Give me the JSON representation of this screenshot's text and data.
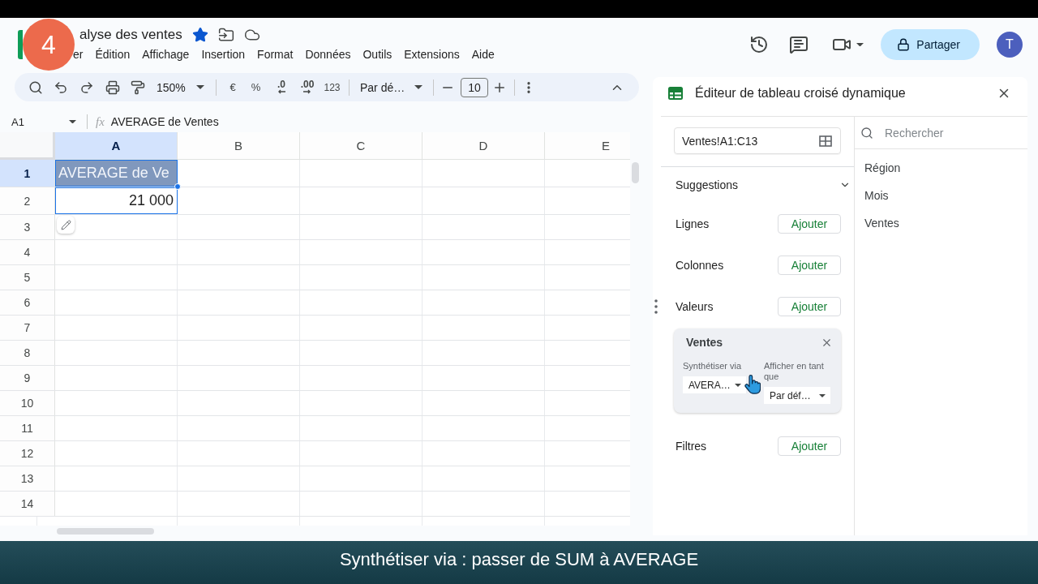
{
  "badge": {
    "text": "4"
  },
  "header": {
    "title": "alyse des ventes",
    "starred": true,
    "menu": [
      {
        "label": "er"
      },
      {
        "label": "Édition"
      },
      {
        "label": "Affichage"
      },
      {
        "label": "Insertion"
      },
      {
        "label": "Format"
      },
      {
        "label": "Données"
      },
      {
        "label": "Outils"
      },
      {
        "label": "Extensions"
      },
      {
        "label": "Aide"
      }
    ]
  },
  "share": {
    "label": "Partager"
  },
  "avatar": {
    "initial": "T"
  },
  "toolbar": {
    "zoom": "150%",
    "currency": "€",
    "percent": "%",
    "decimal_decrease": ".0",
    "decimal_increase": ".00",
    "number_format": "123",
    "font": "Par dé…",
    "font_size": "10"
  },
  "formula_bar": {
    "cell_ref": "A1",
    "function_label": "fx",
    "formula": "AVERAGE de Ventes"
  },
  "sheet": {
    "columns": [
      {
        "label": "A",
        "selected": true
      },
      {
        "label": "B",
        "selected": false
      },
      {
        "label": "C",
        "selected": false
      },
      {
        "label": "D",
        "selected": false
      },
      {
        "label": "E",
        "selected": false
      }
    ],
    "rows": [
      {
        "label": "1",
        "selected": true,
        "cells": [
          {
            "value": "AVERAGE de Ve",
            "kind": "header",
            "selected": true,
            "active": true
          }
        ]
      },
      {
        "label": "2",
        "selected": false,
        "cells": [
          {
            "value": "21 000",
            "kind": "number",
            "selected": true,
            "active": false
          }
        ]
      },
      {
        "label": "3",
        "selected": false
      },
      {
        "label": "4",
        "selected": false
      },
      {
        "label": "5",
        "selected": false
      },
      {
        "label": "6",
        "selected": false
      },
      {
        "label": "7",
        "selected": false
      },
      {
        "label": "8",
        "selected": false
      },
      {
        "label": "9",
        "selected": false
      },
      {
        "label": "10",
        "selected": false
      },
      {
        "label": "11",
        "selected": false
      },
      {
        "label": "12",
        "selected": false
      },
      {
        "label": "13",
        "selected": false
      },
      {
        "label": "14",
        "selected": false
      }
    ]
  },
  "pivot_editor": {
    "title": "Éditeur de tableau croisé dynamique",
    "range": "Ventes!A1:C13",
    "suggestions": {
      "label": "Suggestions",
      "expanded": false
    },
    "sections": [
      {
        "label": "Lignes",
        "button": "Ajouter"
      },
      {
        "label": "Colonnes",
        "button": "Ajouter"
      },
      {
        "label": "Valeurs",
        "button": "Ajouter",
        "cards": [
          {
            "title": "Ventes",
            "summarize_label": "Synthétiser via",
            "summarize_value": "AVERA…",
            "show_as_label": "Afficher en tant que",
            "show_as_value": "Par déf…"
          }
        ]
      },
      {
        "label": "Filtres",
        "button": "Ajouter"
      }
    ]
  },
  "field_list": {
    "search_placeholder": "Rechercher",
    "items": [
      "Région",
      "Mois",
      "Ventes"
    ]
  },
  "caption": "Synthétiser via : passer de SUM à AVERAGE"
}
